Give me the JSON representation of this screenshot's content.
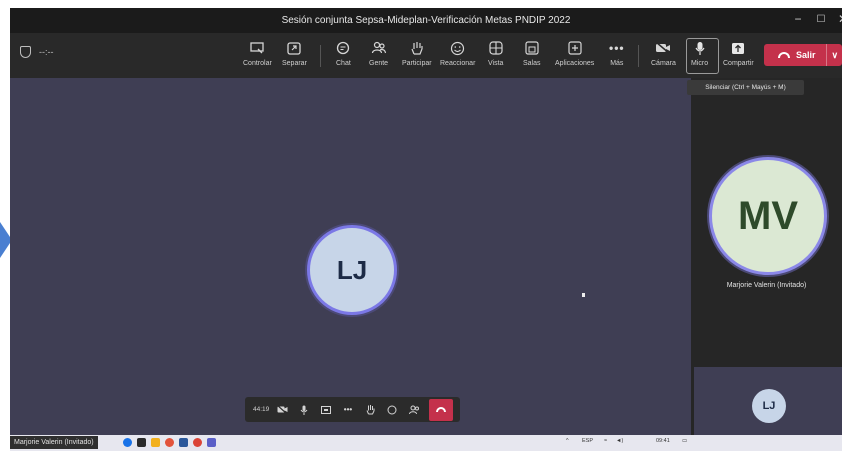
{
  "window": {
    "title": "Sesión conjunta Sepsa-Mideplan-Verificación Metas PNDIP 2022",
    "controls": [
      "−",
      "☐",
      "✕"
    ]
  },
  "toolbar": {
    "timer": "--:--",
    "buttons": [
      {
        "label": "Controlar",
        "icon": "share-control-icon"
      },
      {
        "label": "Separar",
        "icon": "pop-out-icon"
      },
      {
        "label": "Chat",
        "icon": "chat-icon"
      },
      {
        "label": "Gente",
        "icon": "people-icon"
      },
      {
        "label": "Participar",
        "icon": "raise-hand-icon"
      },
      {
        "label": "Reaccionar",
        "icon": "react-icon"
      },
      {
        "label": "Vista",
        "icon": "view-icon"
      },
      {
        "label": "Salas",
        "icon": "rooms-icon"
      },
      {
        "label": "Aplicaciones",
        "icon": "apps-icon"
      },
      {
        "label": "Más",
        "icon": "more-icon"
      },
      {
        "label": "Cámara",
        "icon": "camera-off-icon"
      },
      {
        "label": "Micro",
        "icon": "mic-icon"
      },
      {
        "label": "Compartir",
        "icon": "share-icon"
      }
    ],
    "leave_label": "Salir"
  },
  "tooltip": "Silenciar (Ctrl + Mayús + M)",
  "stage": {
    "main_initials": "LJ"
  },
  "floating_bar": {
    "time": "44:19"
  },
  "panel": {
    "participant_initials": "MV",
    "participant_name": "Marjorie Valerin (Invitado)",
    "self_initials": "LJ"
  },
  "bottom": {
    "name_tag": "Marjorie Valerin (Invitado)",
    "tray_lang": "ESP",
    "tray_time": "09:41"
  },
  "colors": {
    "stage_bg": "#3f3e54",
    "leave_red": "#c4314b",
    "ring_purple": "#7b78e6"
  }
}
